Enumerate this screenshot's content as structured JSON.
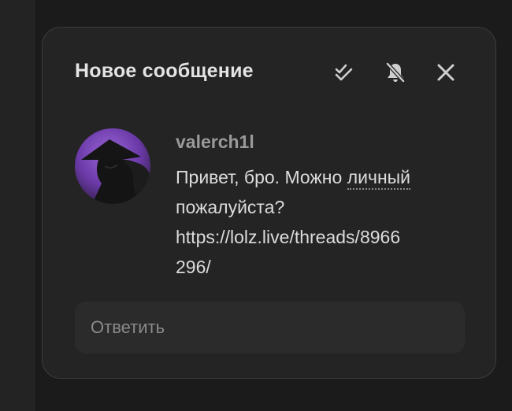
{
  "notification": {
    "title": "Новое сообщение",
    "actions": {
      "mark_read_icon": "double-check-icon",
      "mute_icon": "bell-off-icon",
      "close_icon": "close-icon"
    }
  },
  "message": {
    "avatar_icon": "user-avatar",
    "username": "valerch1l",
    "text_lines": {
      "line1_before": "Привет, бро. Можно ",
      "line1_link": "личный",
      "line2": "пожалуйста?",
      "line3": "https://lolz.live/threads/8966",
      "line4": "296/"
    }
  },
  "reply": {
    "placeholder": "Ответить"
  },
  "colors": {
    "background": "#1b1b1b",
    "panel": "#242424",
    "panel_border": "#3c3c3c",
    "title": "#e4e4e4",
    "username": "#9a9a9a",
    "text": "#dcdcdc",
    "avatar_accent": "#7c4bbd"
  }
}
